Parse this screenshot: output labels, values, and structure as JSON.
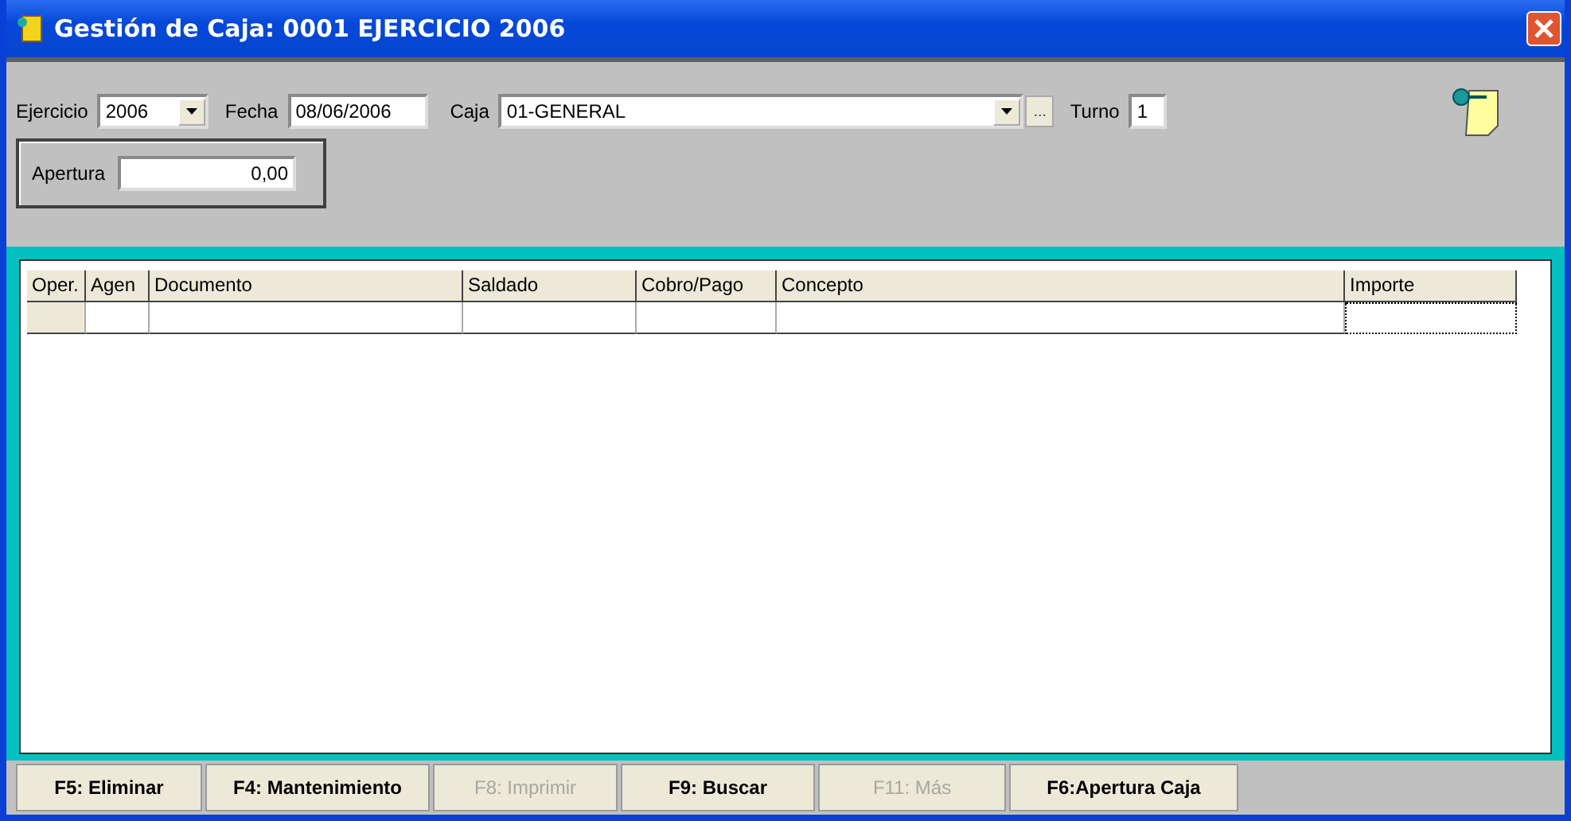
{
  "window": {
    "title": "Gestión de Caja: 0001 EJERCICIO 2006"
  },
  "filters": {
    "ejercicio": {
      "label": "Ejercicio",
      "value": "2006"
    },
    "fecha": {
      "label": "Fecha",
      "value": "08/06/2006"
    },
    "caja": {
      "label": "Caja",
      "value": "01-GENERAL",
      "browse": "..."
    },
    "turno": {
      "label": "Turno",
      "value": "1"
    }
  },
  "apertura": {
    "label": "Apertura",
    "value": "0,00"
  },
  "table": {
    "columns": [
      "Oper.",
      "Agen",
      "Documento",
      "Saldado",
      "Cobro/Pago",
      "Concepto",
      "Importe"
    ]
  },
  "buttons": [
    {
      "label": "F5: Eliminar",
      "disabled": false
    },
    {
      "label": "F4: Mantenimiento",
      "disabled": false
    },
    {
      "label": "F8: Imprimir",
      "disabled": true
    },
    {
      "label": "F9: Buscar",
      "disabled": false
    },
    {
      "label": "F11: Más",
      "disabled": true
    },
    {
      "label": "F6:Apertura Caja",
      "disabled": false
    }
  ]
}
